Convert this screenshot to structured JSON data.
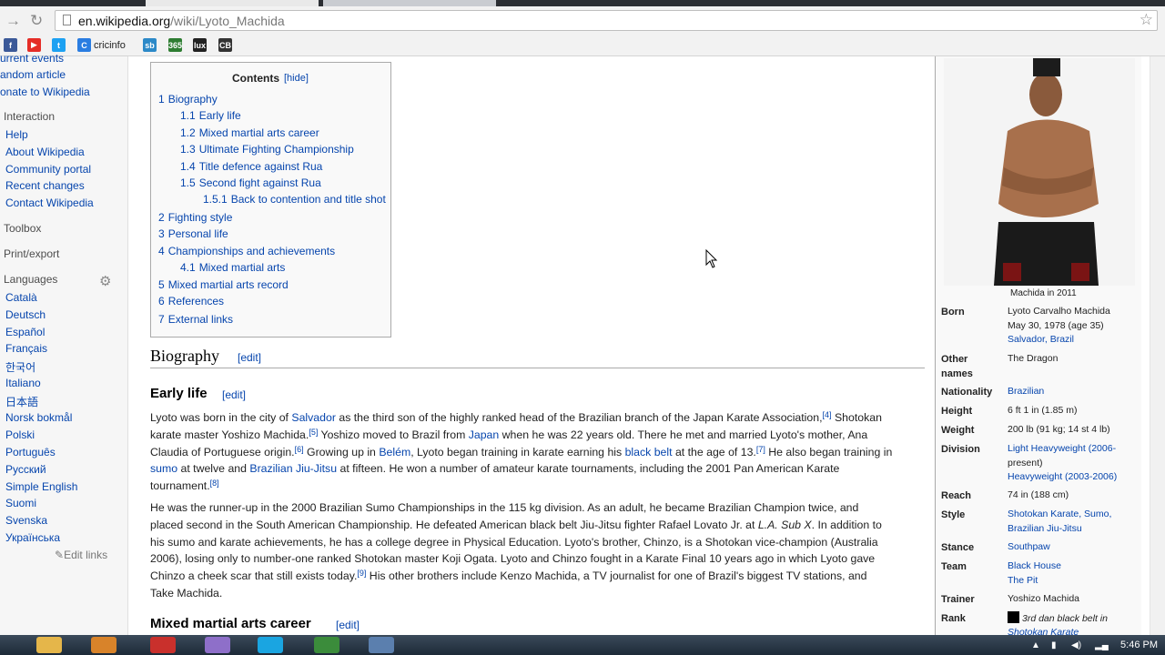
{
  "browser": {
    "url_host": "en.wikipedia.org",
    "url_path": "/wiki/Lyoto_Machida",
    "bookmarks": [
      {
        "icon": "facebook-icon",
        "label": "",
        "color": "#3b5998",
        "glyph": "f"
      },
      {
        "icon": "youtube-icon",
        "label": "",
        "color": "#e52d27",
        "glyph": "▶"
      },
      {
        "icon": "twitter-icon",
        "label": "",
        "color": "#1da1f2",
        "glyph": "t"
      },
      {
        "icon": "cricinfo-icon",
        "label": "cricinfo",
        "color": "#2a7de1",
        "glyph": "C"
      },
      {
        "icon": "sb-icon",
        "label": "",
        "color": "#2c89c8",
        "glyph": "sb"
      },
      {
        "icon": "365-icon",
        "label": "",
        "color": "#2e7d32",
        "glyph": "365"
      },
      {
        "icon": "luxbet-icon",
        "label": "",
        "color": "#222222",
        "glyph": "lux"
      },
      {
        "icon": "cb-icon",
        "label": "",
        "color": "#333333",
        "glyph": "CB"
      }
    ]
  },
  "sidebar": {
    "items": [
      {
        "label": "urrent events",
        "type": "item"
      },
      {
        "label": "andom article",
        "type": "item"
      },
      {
        "label": "onate to Wikipedia",
        "type": "item"
      },
      {
        "label": "Interaction",
        "type": "head"
      },
      {
        "label": "Help",
        "type": "item"
      },
      {
        "label": "About Wikipedia",
        "type": "item"
      },
      {
        "label": "Community portal",
        "type": "item"
      },
      {
        "label": "Recent changes",
        "type": "item"
      },
      {
        "label": "Contact Wikipedia",
        "type": "item"
      },
      {
        "label": "Toolbox",
        "type": "head"
      },
      {
        "label": "Print/export",
        "type": "head"
      },
      {
        "label": "Languages",
        "type": "head"
      },
      {
        "label": "Català",
        "type": "item"
      },
      {
        "label": "Deutsch",
        "type": "item"
      },
      {
        "label": "Español",
        "type": "item"
      },
      {
        "label": "Français",
        "type": "item"
      },
      {
        "label": "한국어",
        "type": "item"
      },
      {
        "label": "Italiano",
        "type": "item"
      },
      {
        "label": "日本語",
        "type": "item"
      },
      {
        "label": "Norsk bokmål",
        "type": "item"
      },
      {
        "label": "Polski",
        "type": "item"
      },
      {
        "label": "Português",
        "type": "item"
      },
      {
        "label": "Русский",
        "type": "item"
      },
      {
        "label": "Simple English",
        "type": "item"
      },
      {
        "label": "Suomi",
        "type": "item"
      },
      {
        "label": "Svenska",
        "type": "item"
      },
      {
        "label": "Українська",
        "type": "item"
      }
    ],
    "edit_links": "Edit links"
  },
  "toc": {
    "title": "Contents",
    "hide": "[hide]",
    "entries": [
      {
        "num": "1",
        "label": "Biography"
      },
      {
        "num": "1.1",
        "label": "Early life"
      },
      {
        "num": "1.2",
        "label": "Mixed martial arts career"
      },
      {
        "num": "1.3",
        "label": "Ultimate Fighting Championship"
      },
      {
        "num": "1.4",
        "label": "Title defence against Rua"
      },
      {
        "num": "1.5",
        "label": "Second fight against Rua"
      },
      {
        "num": "1.5.1",
        "label": "Back to contention and title shot"
      },
      {
        "num": "2",
        "label": "Fighting style"
      },
      {
        "num": "3",
        "label": "Personal life"
      },
      {
        "num": "4",
        "label": "Championships and achievements"
      },
      {
        "num": "4.1",
        "label": "Mixed martial arts"
      },
      {
        "num": "5",
        "label": "Mixed martial arts record"
      },
      {
        "num": "6",
        "label": "References"
      },
      {
        "num": "7",
        "label": "External links"
      }
    ]
  },
  "article": {
    "biography": "Biography",
    "early_life": "Early life",
    "mma_career": "Mixed martial arts career",
    "edit": "[edit]",
    "p1": [
      [
        "Lyoto was born in the city of ",
        "#Salvador",
        " as the third son of the highly ranked head of the Brazilian branch of the Japan Karate Association,",
        "^[4]",
        " Shotokan"
      ],
      [
        "karate master Yoshizo Machida.",
        "^[5]",
        " Yoshizo moved to Brazil from ",
        "#Japan",
        " when he was 22 years old. There he met and married Lyoto's mother, Ana"
      ],
      [
        "Claudia of Portuguese origin.",
        "^[6]",
        " Growing up in ",
        "#Belém",
        ", Lyoto began training in karate earning his ",
        "#black belt",
        " at the age of 13.",
        "^[7]",
        " He also began training in"
      ],
      [
        "#sumo",
        " at twelve and ",
        "#Brazilian Jiu-Jitsu",
        " at fifteen. He won a number of amateur karate tournaments, including the 2001 Pan American Karate"
      ],
      [
        "tournament.",
        "^[8]"
      ]
    ],
    "p2": [
      [
        "He was the runner-up in the 2000 Brazilian Sumo Championships in the 115 kg division. As an adult, he became Brazilian Champion twice, and"
      ],
      [
        "placed second in the South American Championship. He defeated American black belt Jiu-Jitsu fighter Rafael Lovato Jr. at ",
        "~L.A. Sub X",
        ". In addition to"
      ],
      [
        "his sumo and karate achievements, he has a college degree in Physical Education. Lyoto's brother, Chinzo, is a Shotokan vice-champion (Australia"
      ],
      [
        "2006), losing only to number-one ranked Shotokan master Koji Ogata. Lyoto and Chinzo fought in a Karate Final 10 years ago in which Lyoto gave"
      ],
      [
        "Chinzo a cheek scar that still exists today.",
        "^[9]",
        " His other brothers include Kenzo Machida, a TV journalist for one of Brazil's biggest TV stations, and"
      ],
      [
        "Take Machida."
      ]
    ]
  },
  "infobox": {
    "caption": "Machida in 2011",
    "rows": [
      {
        "label": "Born",
        "lines": [
          "Lyoto Carvalho Machida",
          "May 30, 1978 (age 35)",
          "#Salvador, Brazil"
        ]
      },
      {
        "label": "Other names",
        "lines": [
          "The Dragon"
        ]
      },
      {
        "label": "Nationality",
        "lines": [
          "#Brazilian"
        ]
      },
      {
        "label": "Height",
        "lines": [
          "6 ft 1 in (1.85 m)"
        ]
      },
      {
        "label": "Weight",
        "lines": [
          "200 lb (91 kg; 14 st 4 lb)"
        ]
      },
      {
        "label": "Division",
        "lines": [
          "#Light Heavyweight (2006-",
          "present)",
          "#Heavyweight (2003-2006)"
        ]
      },
      {
        "label": "Reach",
        "lines": [
          "74 in (188 cm)"
        ]
      },
      {
        "label": "Style",
        "lines": [
          "#Shotokan Karate, Sumo,",
          "#Brazilian Jiu-Jitsu"
        ]
      },
      {
        "label": "Stance",
        "lines": [
          "#Southpaw"
        ]
      },
      {
        "label": "Team",
        "lines": [
          "#Black House",
          "#The Pit"
        ]
      },
      {
        "label": "Trainer",
        "lines": [
          "Yoshizo Machida"
        ]
      },
      {
        "label": "Rank",
        "lines": [
          "3rd dan black belt in",
          "#Shotokan Karate"
        ]
      }
    ]
  },
  "taskbar": {
    "clock": "5:46 PM"
  },
  "colors": {
    "link": "#0645ad",
    "sidebar_bg": "#f6f6f6",
    "infobox_bg": "#f9f9f9"
  }
}
